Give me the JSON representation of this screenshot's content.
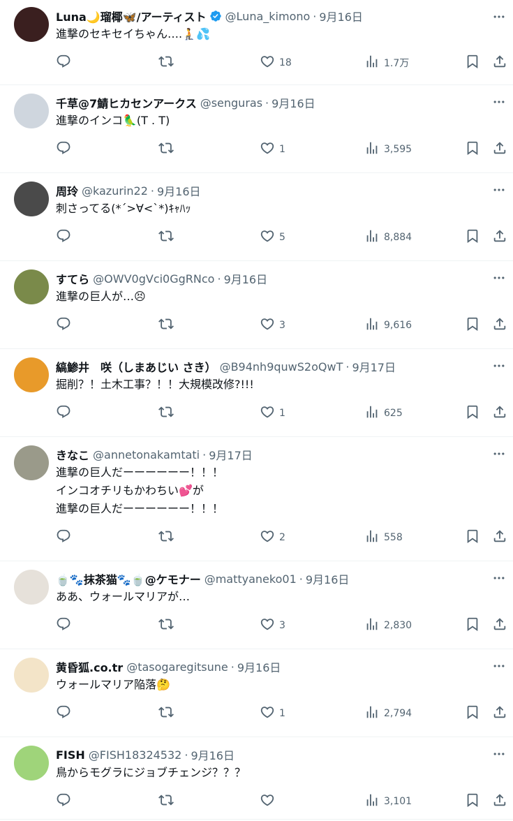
{
  "tweets": [
    {
      "name": "Luna🌙瑠椰🦋/アーティスト",
      "verified": true,
      "handle": "@Luna_kimono",
      "date": "9月16日",
      "lines": [
        "進撃のセキセイちゃん….🧎💦"
      ],
      "likes": "18",
      "views": "1.7万",
      "avatar_color": "#3a1f1f"
    },
    {
      "name": "千草@7鯖ヒカセンアークス",
      "verified": false,
      "handle": "@senguras",
      "date": "9月16日",
      "lines": [
        "進撃のインコ🦜(T . T)"
      ],
      "likes": "1",
      "views": "3,595",
      "avatar_color": "#cfd6de"
    },
    {
      "name": "周玲",
      "verified": false,
      "handle": "@kazurin22",
      "date": "9月16日",
      "lines": [
        "刺さってる(*´>∀<`*)ｷｬﾊｯ"
      ],
      "likes": "5",
      "views": "8,884",
      "avatar_color": "#4a4a4a"
    },
    {
      "name": "すてら",
      "verified": false,
      "handle": "@OWV0gVci0GgRNco",
      "date": "9月16日",
      "lines": [
        "進撃の巨人が…😣"
      ],
      "likes": "3",
      "views": "9,616",
      "avatar_color": "#7a8a4a"
    },
    {
      "name": "縞鯵井　咲（しまあじい さき）",
      "verified": false,
      "handle": "@B94nh9quwS2oQwT",
      "date": "9月17日",
      "lines": [
        "掘削？！土木工事？！！大規模改修?!!!"
      ],
      "likes": "1",
      "views": "625",
      "avatar_color": "#e89a2a"
    },
    {
      "name": "きなこ",
      "verified": false,
      "handle": "@annetonakamtati",
      "date": "9月17日",
      "lines": [
        "進撃の巨人だーーーーーー！！！",
        "インコオチリもかわちい💕が",
        "進撃の巨人だーーーーーー！！！"
      ],
      "likes": "2",
      "views": "558",
      "avatar_color": "#9a9a8a"
    },
    {
      "name": "🍵🐾抹茶猫🐾🍵@ケモナー",
      "verified": false,
      "handle": "@mattyaneko01",
      "date": "9月16日",
      "lines": [
        "ああ、ウォールマリアが…"
      ],
      "likes": "3",
      "views": "2,830",
      "avatar_color": "#e6e1da"
    },
    {
      "name": "黄昏狐.co.tr",
      "verified": false,
      "handle": "@tasogaregitsune",
      "date": "9月16日",
      "lines": [
        "ウォールマリア陥落🤔"
      ],
      "likes": "1",
      "views": "2,794",
      "avatar_color": "#f3e4c8"
    },
    {
      "name": "FISH",
      "verified": false,
      "handle": "@FISH18324532",
      "date": "9月16日",
      "lines": [
        "鳥からモグラにジョブチェンジ？？？"
      ],
      "likes": "",
      "views": "3,101",
      "avatar_color": "#9fd47a"
    }
  ],
  "icons": {
    "reply": "reply-icon",
    "retweet": "retweet-icon",
    "like": "like-icon",
    "views": "views-icon",
    "bookmark": "bookmark-icon",
    "share": "share-icon",
    "more": "more-icon",
    "verified": "verified-badge-icon"
  },
  "colors": {
    "text": "#0f1419",
    "muted": "#536471",
    "border": "#eff3f4",
    "verified": "#1d9bf0"
  }
}
